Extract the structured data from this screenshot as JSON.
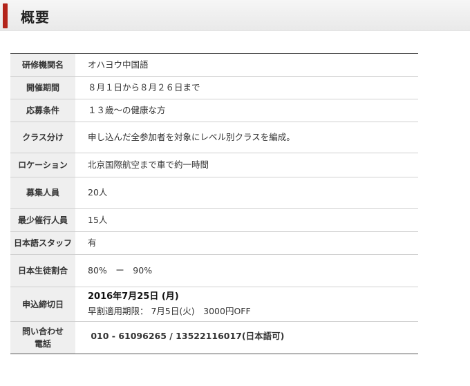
{
  "heading": {
    "title": "概要"
  },
  "rows": [
    {
      "label": "研修機関名",
      "value": "オハヨウ中国語"
    },
    {
      "label": "開催期間",
      "value": "８月１日から８月２６日まで"
    },
    {
      "label": "応募条件",
      "value": "１３歳〜の健康な方"
    },
    {
      "label": "クラス分け",
      "value": "申し込んだ全参加者を対象にレベル別クラスを編成。"
    },
    {
      "label": "ロケーション",
      "value": "北京国際航空まで車で約一時間"
    },
    {
      "label": "募集人員",
      "value": "20人"
    },
    {
      "label": "最少催行人員",
      "value": "15人"
    },
    {
      "label": "日本語スタッフ",
      "value": "有"
    },
    {
      "label": "日本生徒割合",
      "value": "80%　ー　90%"
    },
    {
      "label": "申込締切日",
      "value": "2016年7月25日 (月)",
      "sub": "早割適用期限：  7月5日(火)　3000円OFF"
    },
    {
      "label": "問い合わせ\n電話",
      "value": " 010 - 61096265 / 13522116017(日本語可)"
    }
  ]
}
